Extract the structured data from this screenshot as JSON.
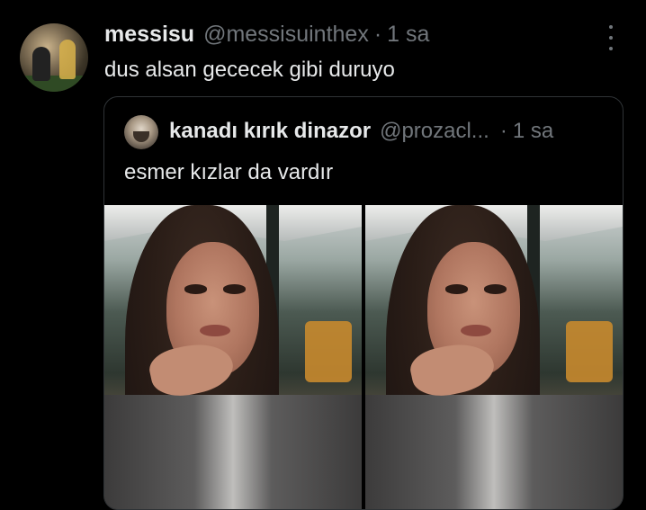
{
  "tweet": {
    "author_name": "messisu",
    "author_handle": "@messisuinthex",
    "separator": "·",
    "time": "1 sa",
    "text": "dus alsan gececek gibi duruyo"
  },
  "quote": {
    "author_name": "kanadı kırık dinazor",
    "author_handle": "@prozacl...",
    "separator": "·",
    "time": "1 sa",
    "text": "esmer kızlar da vardır",
    "media_count": 2
  },
  "icons": {
    "more": "more-vertical-icon"
  },
  "colors": {
    "background": "#000000",
    "primary_text": "#e7e9ea",
    "secondary_text": "#71767b",
    "border": "#2f3336"
  }
}
